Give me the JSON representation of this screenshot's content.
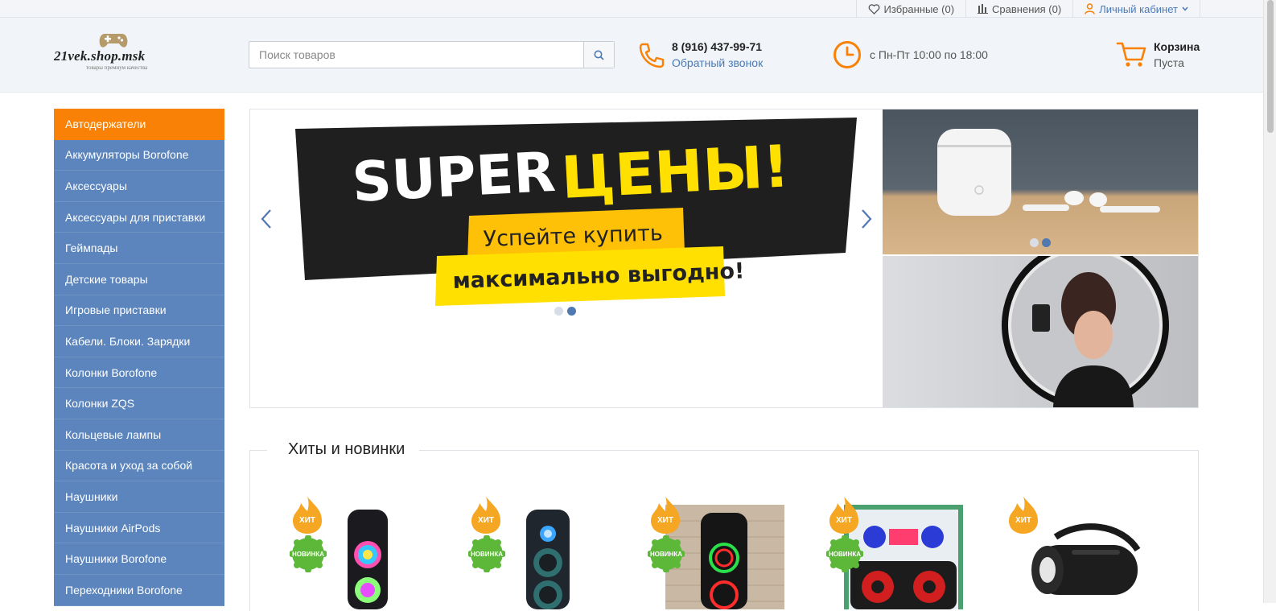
{
  "topbar": {
    "favorites": "Избранные (0)",
    "compare": "Сравнения (0)",
    "account": "Личный кабинет"
  },
  "header": {
    "logo_name": "21vek.shop.msk",
    "logo_tagline": "товары премиум качества",
    "search_placeholder": "Поиск товаров",
    "phone": "8 (916) 437-99-71",
    "callback": "Обратный звонок",
    "hours": "с Пн-Пт 10:00 по 18:00",
    "cart_title": "Корзина",
    "cart_status": "Пуста"
  },
  "sidebar": {
    "items": [
      {
        "label": "Автодержатели",
        "active": true
      },
      {
        "label": "Аккумуляторы Borofone"
      },
      {
        "label": "Аксессуары"
      },
      {
        "label": "Аксессуары для приставки"
      },
      {
        "label": "Геймпады"
      },
      {
        "label": "Детские товары"
      },
      {
        "label": "Игровые приставки"
      },
      {
        "label": "Кабели. Блоки. Зарядки"
      },
      {
        "label": "Колонки Borofone"
      },
      {
        "label": "Колонки ZQS"
      },
      {
        "label": "Кольцевые лампы"
      },
      {
        "label": "Красота и уход за собой"
      },
      {
        "label": "Наушники"
      },
      {
        "label": "Наушники AirPods"
      },
      {
        "label": "Наушники Borofone"
      },
      {
        "label": "Переходники Borofone"
      }
    ]
  },
  "banner": {
    "promo_super": "SUPER",
    "promo_prices": "ЦЕНЫ!",
    "promo_line1": "Успейте купить",
    "promo_line2": "максимально выгодно!"
  },
  "hits": {
    "title": "Хиты и новинки",
    "badge_hit": "ХИТ",
    "badge_new": "НОВИНКА"
  },
  "colors": {
    "accent_orange": "#f98105",
    "sidebar_blue": "#5b85bc",
    "link_blue": "#4a7ab8",
    "badge_new_green": "#5db83a"
  }
}
